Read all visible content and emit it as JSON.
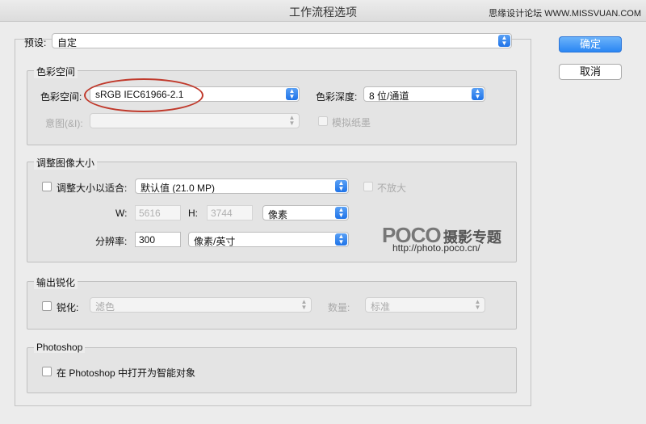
{
  "window": {
    "title": "工作流程选项",
    "watermark": "思缘设计论坛 WWW.MISSVUAN.COM"
  },
  "preset": {
    "label": "预设:",
    "value": "自定"
  },
  "buttons": {
    "ok": "确定",
    "cancel": "取消"
  },
  "color_space": {
    "group_title": "色彩空间",
    "space_label": "色彩空间:",
    "space_value": "sRGB IEC61966-2.1",
    "depth_label": "色彩深度:",
    "depth_value": "8 位/通道",
    "intent_label": "意图(&I):",
    "intent_value": "",
    "simulate_paper_label": "模拟纸墨"
  },
  "image_size": {
    "group_title": "调整图像大小",
    "resize_label": "调整大小以适合:",
    "resize_value": "默认值 (21.0 MP)",
    "dont_enlarge_label": "不放大",
    "w_label": "W:",
    "w_value": "5616",
    "h_label": "H:",
    "h_value": "3744",
    "unit_value": "像素",
    "resolution_label": "分辨率:",
    "resolution_value": "300",
    "resolution_unit": "像素/英寸"
  },
  "sharpen": {
    "group_title": "输出锐化",
    "sharpen_label": "锐化:",
    "sharpen_value": "滤色",
    "amount_label": "数量:",
    "amount_value": "标准"
  },
  "photoshop": {
    "group_title": "Photoshop",
    "smart_object_label": "在 Photoshop 中打开为智能对象"
  },
  "watermark_logo": {
    "brand": "POCO",
    "cn": "摄影专题",
    "url": "http://photo.poco.cn/"
  }
}
